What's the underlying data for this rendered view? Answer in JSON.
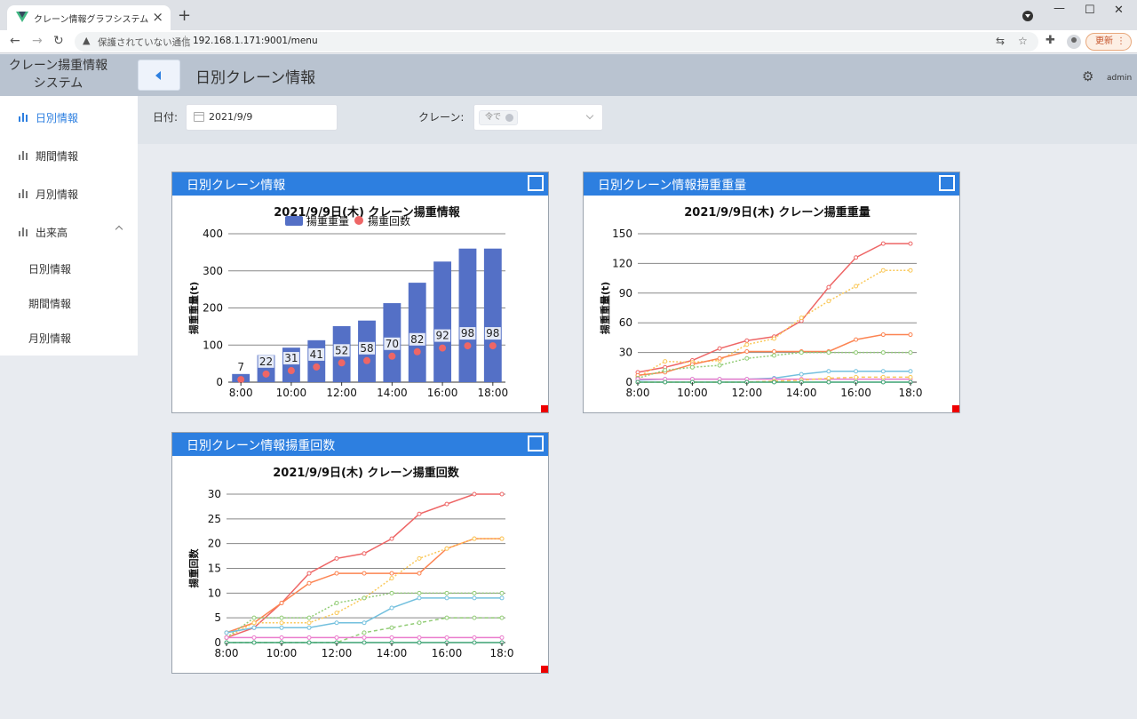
{
  "browser": {
    "tab_title": "クレーン情報グラフシステム",
    "not_secure": "保護されていない通信",
    "url": "192.168.1.171:9001/menu",
    "update_label": "更新"
  },
  "app": {
    "brand_line1": "クレーン揚重情報",
    "brand_line2": "システム",
    "page_title": "日別クレーン情報",
    "user": "admin"
  },
  "sidebar": {
    "items": [
      {
        "label": "日別情報"
      },
      {
        "label": "期間情報"
      },
      {
        "label": "月別情報"
      },
      {
        "label": "出来高"
      }
    ],
    "subitems": [
      {
        "label": "日別情報"
      },
      {
        "label": "期間情報"
      },
      {
        "label": "月別情報"
      }
    ]
  },
  "filter": {
    "date_label": "日付:",
    "date_value": "2021/9/9",
    "crane_label": "クレーン:",
    "crane_tag": "令で"
  },
  "cards": [
    {
      "title": "日別クレーン情報"
    },
    {
      "title": "日別クレーン情報揚重重量"
    },
    {
      "title": "日別クレーン情報揚重回数"
    }
  ],
  "chart_data": [
    {
      "type": "bar",
      "title": "2021/9/9日(木) クレーン揚重情報",
      "ylabel": "揚重重量(t)",
      "xlabel": "",
      "ylim": [
        0,
        400
      ],
      "yticks": [
        0,
        100,
        200,
        300,
        400
      ],
      "xticks": [
        "8:00",
        "10:00",
        "12:00",
        "14:00",
        "16:00",
        "18:00"
      ],
      "categories": [
        "8:00",
        "9:00",
        "10:00",
        "11:00",
        "12:00",
        "13:00",
        "14:00",
        "15:00",
        "16:00",
        "17:00",
        "18:00"
      ],
      "legend": "top-center",
      "grid": true,
      "series": [
        {
          "name": "揚重重量",
          "kind": "bar",
          "color": "#5470c6",
          "values": [
            22,
            73,
            93,
            113,
            151,
            166,
            213,
            268,
            325,
            360,
            360
          ]
        },
        {
          "name": "揚重回数",
          "kind": "scatter",
          "color": "#ee6666",
          "values": [
            7,
            22,
            31,
            41,
            52,
            58,
            70,
            82,
            92,
            98,
            98
          ]
        }
      ]
    },
    {
      "type": "line",
      "title": "2021/9/9日(木) クレーン揚重重量",
      "ylabel": "揚重重量(t)",
      "xlabel": "",
      "ylim": [
        0,
        150
      ],
      "yticks": [
        0,
        30,
        60,
        90,
        120,
        150
      ],
      "xticks": [
        "8:00",
        "10:00",
        "12:00",
        "14:00",
        "16:00",
        "18:0"
      ],
      "x": [
        "8:00",
        "9:00",
        "10:00",
        "11:00",
        "12:00",
        "13:00",
        "14:00",
        "15:00",
        "16:00",
        "17:00",
        "18:00"
      ],
      "grid": true,
      "series": [
        {
          "color": "#ee6666",
          "dash": "",
          "values": [
            10,
            15,
            22,
            34,
            42,
            46,
            62,
            96,
            126,
            140,
            140
          ]
        },
        {
          "color": "#fac858",
          "dash": "2,2",
          "values": [
            5,
            21,
            20,
            22,
            38,
            44,
            65,
            82,
            97,
            113,
            113
          ]
        },
        {
          "color": "#fc8452",
          "dash": "",
          "values": [
            7,
            10,
            18,
            24,
            31,
            31,
            31,
            31,
            43,
            48,
            48
          ]
        },
        {
          "color": "#91cc75",
          "dash": "2,2",
          "values": [
            4,
            12,
            15,
            17,
            24,
            27,
            30,
            30,
            30,
            30,
            30
          ]
        },
        {
          "color": "#73c0de",
          "dash": "",
          "values": [
            2,
            3,
            3,
            3,
            3,
            4,
            8,
            11,
            11,
            11,
            11
          ]
        },
        {
          "color": "#ea7ccc",
          "dash": "",
          "values": [
            3,
            3,
            3,
            3,
            3,
            3,
            3,
            3,
            3,
            3,
            3
          ]
        },
        {
          "color": "#fac858",
          "dash": "4,3",
          "values": [
            0,
            0,
            0,
            0,
            0,
            1,
            2,
            4,
            5,
            5,
            5
          ]
        },
        {
          "color": "#3ba272",
          "dash": "",
          "values": [
            0,
            0,
            0,
            0,
            0,
            0,
            0,
            0,
            0,
            0,
            0
          ]
        }
      ]
    },
    {
      "type": "line",
      "title": "2021/9/9日(木) クレーン揚重回数",
      "ylabel": "揚重回数",
      "xlabel": "",
      "ylim": [
        0,
        30
      ],
      "yticks": [
        0,
        5,
        10,
        15,
        20,
        25,
        30
      ],
      "xticks": [
        "8:00",
        "10:00",
        "12:00",
        "14:00",
        "16:00",
        "18:0"
      ],
      "x": [
        "8:00",
        "8:30",
        "9:00",
        "9:30",
        "10:00",
        "10:30",
        "11:00",
        "11:30",
        "12:00",
        "12:30",
        "13:00",
        "13:30",
        "14:00",
        "14:30",
        "15:00",
        "15:30",
        "16:00",
        "16:30",
        "17:00",
        "17:30",
        "18:00"
      ],
      "grid": true,
      "series": [
        {
          "color": "#ee6666",
          "dash": "",
          "values": [
            1,
            3,
            8,
            14,
            17,
            18,
            21,
            26,
            28,
            30,
            30
          ]
        },
        {
          "color": "#fc8452",
          "dash": "",
          "values": [
            2,
            4,
            8,
            12,
            14,
            14,
            14,
            14,
            19,
            21,
            21
          ]
        },
        {
          "color": "#fac858",
          "dash": "2,2",
          "values": [
            1,
            4,
            4,
            4,
            6,
            9,
            13,
            17,
            19,
            21,
            21
          ]
        },
        {
          "color": "#91cc75",
          "dash": "2,2",
          "values": [
            1,
            5,
            5,
            5,
            8,
            9,
            10,
            10,
            10,
            10,
            10
          ]
        },
        {
          "color": "#73c0de",
          "dash": "",
          "values": [
            2,
            3,
            3,
            3,
            4,
            4,
            7,
            9,
            9,
            9,
            9
          ]
        },
        {
          "color": "#91cc75",
          "dash": "4,3",
          "values": [
            0,
            0,
            0,
            0,
            0,
            2,
            3,
            4,
            5,
            5,
            5
          ]
        },
        {
          "color": "#ea7ccc",
          "dash": "",
          "values": [
            1,
            1,
            1,
            1,
            1,
            1,
            1,
            1,
            1,
            1,
            1
          ]
        },
        {
          "color": "#3ba272",
          "dash": "",
          "values": [
            0,
            0,
            0,
            0,
            0,
            0,
            0,
            0,
            0,
            0,
            0
          ]
        }
      ]
    }
  ]
}
